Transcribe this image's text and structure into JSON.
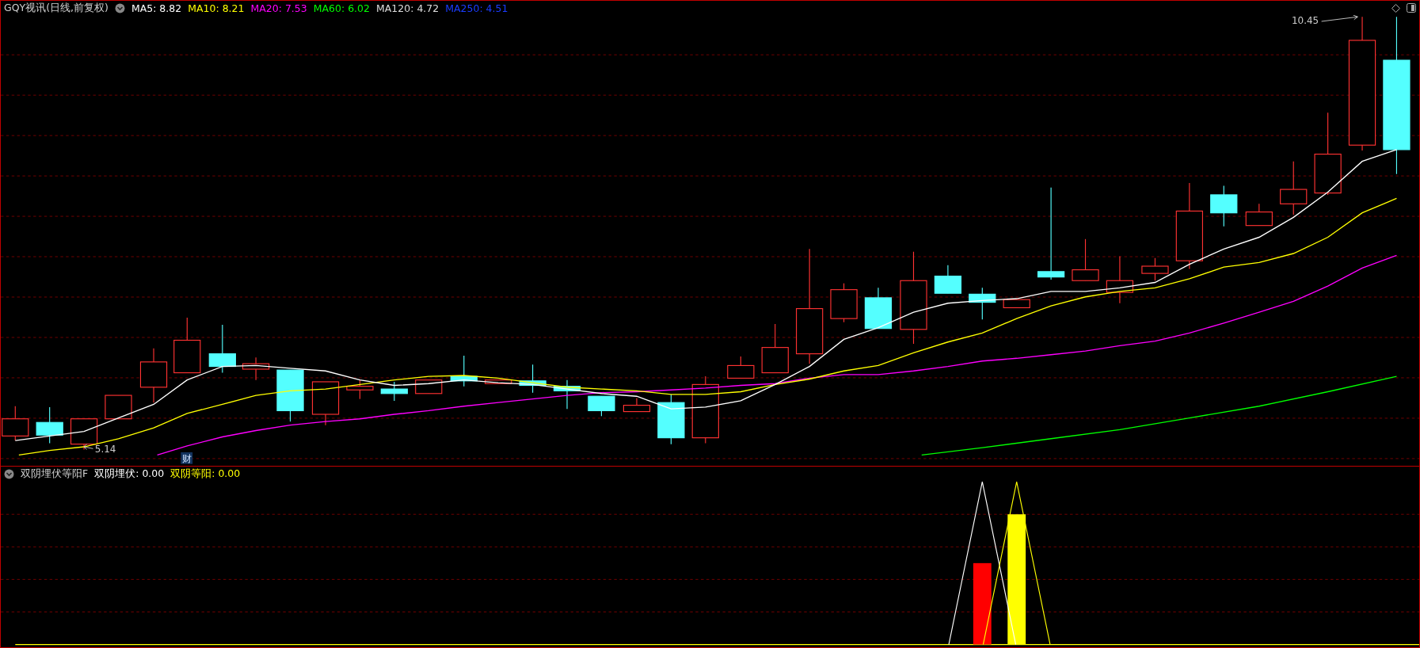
{
  "main_chart": {
    "title": "GQY视讯(日线,前复权)",
    "indicators": [
      {
        "label": "MA5: 8.82",
        "color": "#ffffff"
      },
      {
        "label": "MA10: 8.21",
        "color": "#ffff00"
      },
      {
        "label": "MA20: 7.53",
        "color": "#ff00ff"
      },
      {
        "label": "MA60: 6.02",
        "color": "#00ff00"
      },
      {
        "label": "MA120: 4.72",
        "color": "#dddddd"
      },
      {
        "label": "MA250: 4.51",
        "color": "#1a3cff"
      }
    ],
    "annotations": [
      {
        "kind": "high",
        "text": "10.45"
      },
      {
        "kind": "low",
        "text": "5.14"
      },
      {
        "kind": "badge",
        "text": "财"
      }
    ]
  },
  "indicator_panel": {
    "name": "双阴埋伏等阳F",
    "values": [
      {
        "label": "双阴埋伏: 0.00",
        "color": "#ffffff"
      },
      {
        "label": "双阴等阳: 0.00",
        "color": "#ffff00"
      }
    ]
  }
}
